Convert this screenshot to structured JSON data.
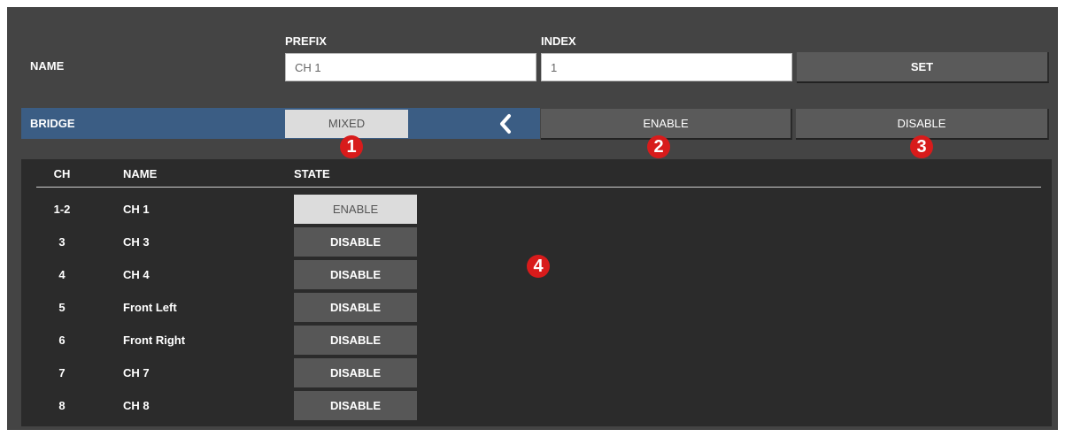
{
  "name_section": {
    "label": "NAME",
    "prefix_label": "PREFIX",
    "index_label": "INDEX",
    "prefix_value": "CH 1",
    "index_value": "1",
    "set_label": "SET"
  },
  "bridge": {
    "label": "BRIDGE",
    "mode": "MIXED",
    "enable_label": "ENABLE",
    "disable_label": "DISABLE",
    "accent_color": "#3b5d84"
  },
  "callouts": [
    "1",
    "2",
    "3",
    "4"
  ],
  "table": {
    "headers": {
      "ch": "CH",
      "name": "NAME",
      "state": "STATE"
    },
    "rows": [
      {
        "ch": "1-2",
        "name": "CH 1",
        "state": "ENABLE"
      },
      {
        "ch": "3",
        "name": "CH 3",
        "state": "DISABLE"
      },
      {
        "ch": "4",
        "name": "CH 4",
        "state": "DISABLE"
      },
      {
        "ch": "5",
        "name": "Front Left",
        "state": "DISABLE"
      },
      {
        "ch": "6",
        "name": "Front Right",
        "state": "DISABLE"
      },
      {
        "ch": "7",
        "name": "CH 7",
        "state": "DISABLE"
      },
      {
        "ch": "8",
        "name": "CH 8",
        "state": "DISABLE"
      }
    ]
  },
  "icons": {
    "collapse": "chevron-left-icon"
  }
}
